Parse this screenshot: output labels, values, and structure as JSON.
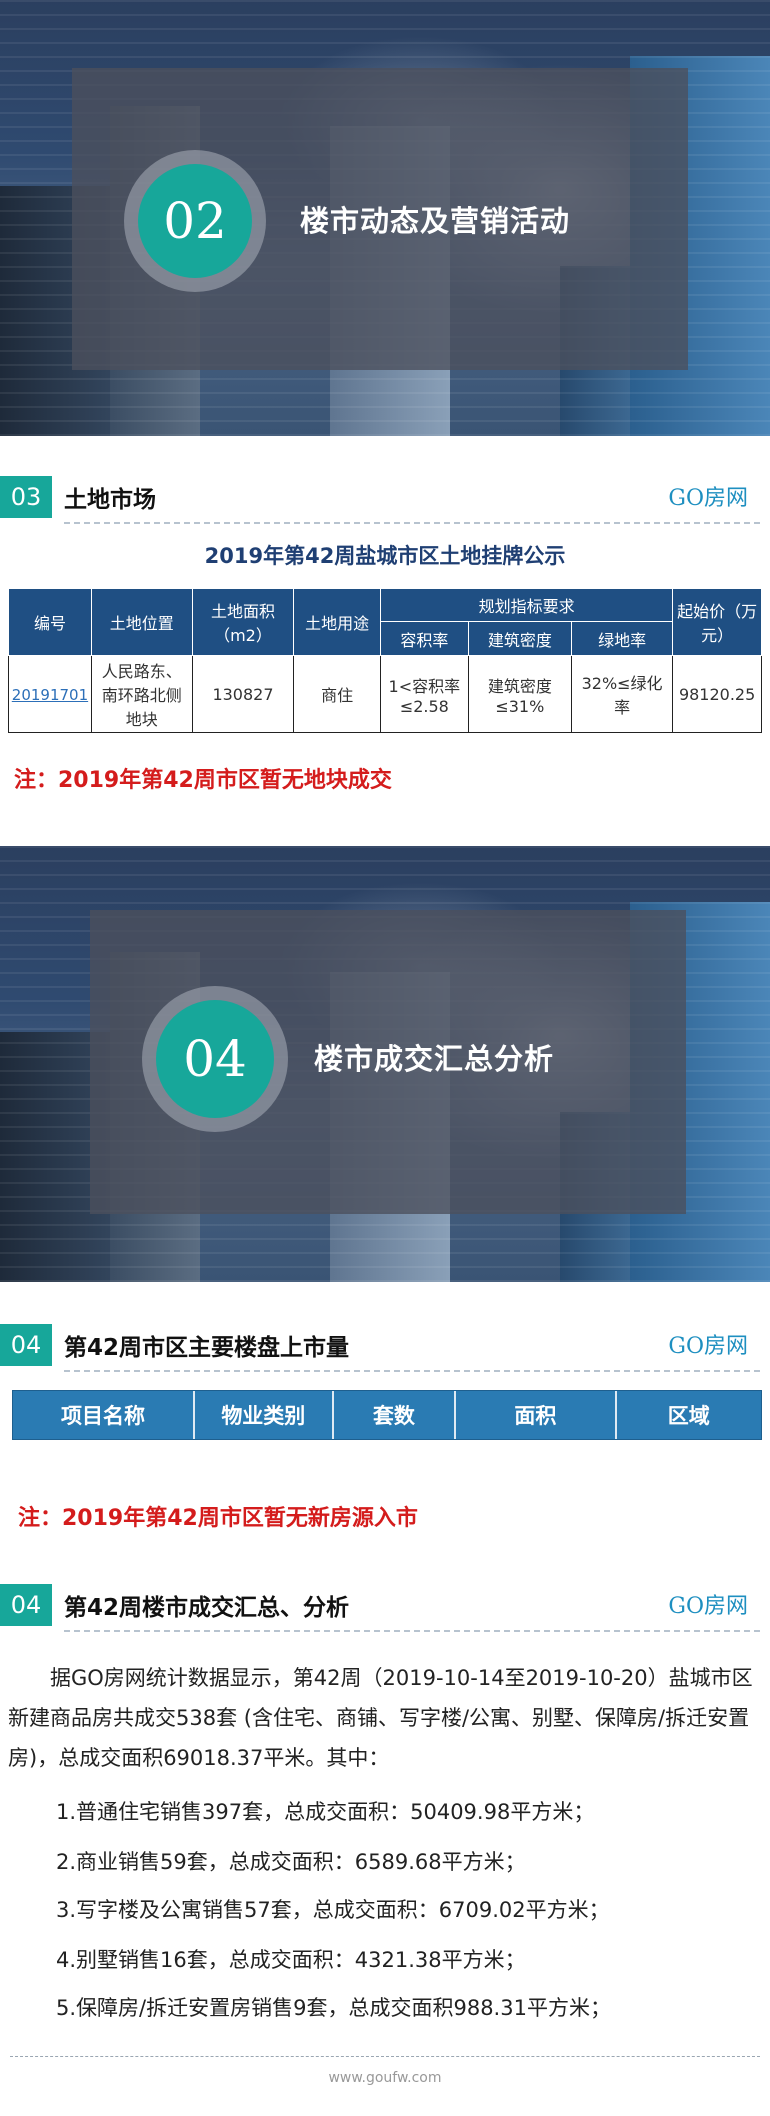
{
  "banner1": {
    "num": "02",
    "title": "楼市动态及营销活动"
  },
  "section_land": {
    "num": "03",
    "title": "土地市场",
    "brand": "GO房网"
  },
  "land_table": {
    "caption": "2019年第42周盐城市区土地挂牌公示",
    "headers": {
      "id": "编号",
      "location": "土地位置",
      "area": "土地面积（m2）",
      "use": "土地用途",
      "plan": "规划指标要求",
      "far": "容积率",
      "density": "建筑密度",
      "green": "绿地率",
      "price": "起始价（万元）"
    },
    "row": {
      "id": "20191701",
      "location": "人民路东、南环路北侧地块",
      "area": "130827",
      "use": "商住",
      "far": "1<容积率≤2.58",
      "density": "建筑密度≤31%",
      "green": "32%≤绿化率",
      "price": "98120.25"
    }
  },
  "note_land": "注：2019年第42周市区暂无地块成交",
  "banner2": {
    "num": "04",
    "title": "楼市成交汇总分析"
  },
  "section_listing": {
    "num": "04",
    "title": "第42周市区主要楼盘上市量",
    "brand": "GO房网"
  },
  "listing_headers": [
    "项目名称",
    "物业类别",
    "套数",
    "面积",
    "区域"
  ],
  "note_listing": "注：2019年第42周市区暂无新房源入市",
  "section_summary": {
    "num": "04",
    "title": "第42周楼市成交汇总、分析",
    "brand": "GO房网"
  },
  "summary": {
    "paragraph": "据GO房网统计数据显示，第42周（2019-10-14至2019-10-20）盐城市区新建商品房共成交538套 (含住宅、商铺、写字楼/公寓、别墅、保障房/拆迁安置房)，总成交面积69018.37平米。其中：",
    "items": [
      "1.普通住宅销售397套，总成交面积：50409.98平方米；",
      "2.商业销售59套，总成交面积：6589.68平方米；",
      "3.写字楼及公寓销售57套，总成交面积：6709.02平方米；",
      "4.别墅销售16套，总成交面积：4321.38平方米；",
      "5.保障房/拆迁安置房销售9套，总成交面积988.31平方米；"
    ]
  },
  "footer": "www.goufw.com",
  "colors": {
    "teal": "#17a79a",
    "navy": "#1f4f83",
    "blue": "#2a7bb3",
    "red": "#d41c1c",
    "brand": "#1e8fc0"
  }
}
